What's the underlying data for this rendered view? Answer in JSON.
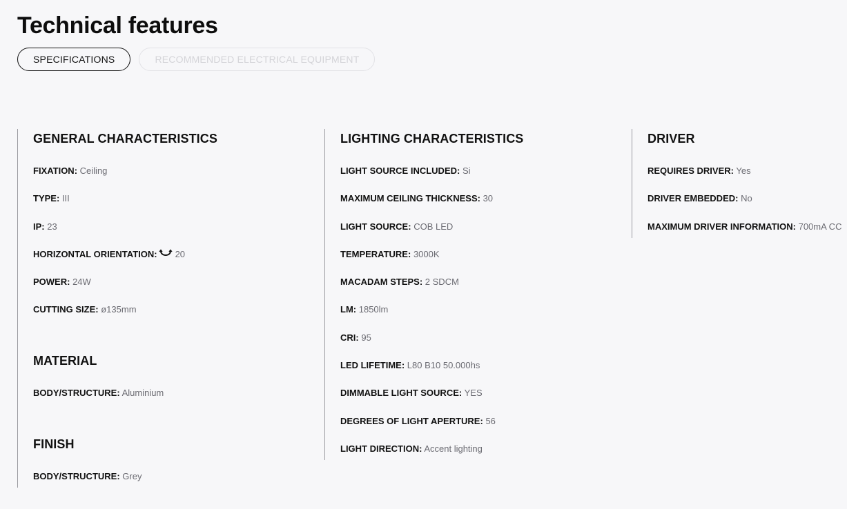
{
  "page": {
    "title": "Technical features"
  },
  "tabs": [
    {
      "label": "SPECIFICATIONS",
      "active": true
    },
    {
      "label": "RECOMMENDED ELECTRICAL EQUIPMENT",
      "active": false
    }
  ],
  "columns": {
    "general": {
      "title": "GENERAL CHARACTERISTICS",
      "rows": [
        {
          "label": "FIXATION:",
          "value": "Ceiling"
        },
        {
          "label": "TYPE:",
          "value": "III"
        },
        {
          "label": "IP:",
          "value": "23"
        },
        {
          "label": "HORIZONTAL ORIENTATION:",
          "value": "20",
          "icon": "rotation-arc-icon"
        },
        {
          "label": "POWER:",
          "value": "24W"
        },
        {
          "label": "CUTTING SIZE:",
          "value": "ø135mm"
        }
      ]
    },
    "material": {
      "title": "MATERIAL",
      "rows": [
        {
          "label": "BODY/STRUCTURE:",
          "value": "Aluminium"
        }
      ]
    },
    "finish": {
      "title": "FINISH",
      "rows": [
        {
          "label": "BODY/STRUCTURE:",
          "value": "Grey"
        }
      ]
    },
    "lighting": {
      "title": "LIGHTING CHARACTERISTICS",
      "rows": [
        {
          "label": "LIGHT SOURCE INCLUDED:",
          "value": "Si"
        },
        {
          "label": "MAXIMUM CEILING THICKNESS:",
          "value": "30"
        },
        {
          "label": "LIGHT SOURCE:",
          "value": "COB LED"
        },
        {
          "label": "TEMPERATURE:",
          "value": "3000K"
        },
        {
          "label": "MACADAM STEPS:",
          "value": "2 SDCM"
        },
        {
          "label": "LM:",
          "value": "1850lm"
        },
        {
          "label": "CRI:",
          "value": "95"
        },
        {
          "label": "LED LIFETIME:",
          "value": "L80 B10 50.000hs"
        },
        {
          "label": "DIMMABLE LIGHT SOURCE:",
          "value": "YES"
        },
        {
          "label": "DEGREES OF LIGHT APERTURE:",
          "value": "56"
        },
        {
          "label": "LIGHT DIRECTION:",
          "value": "Accent lighting"
        }
      ]
    },
    "driver": {
      "title": "DRIVER",
      "rows": [
        {
          "label": "REQUIRES DRIVER:",
          "value": "Yes"
        },
        {
          "label": "DRIVER EMBEDDED:",
          "value": "No"
        },
        {
          "label": "MAXIMUM DRIVER INFORMATION:",
          "value": "700mA CC"
        }
      ]
    }
  },
  "colors": {
    "background": "#f7f7f9",
    "label": "#111111",
    "value": "#6b6b72",
    "divider": "#9a9aa0",
    "tab_inactive": "#d4d4d8"
  }
}
